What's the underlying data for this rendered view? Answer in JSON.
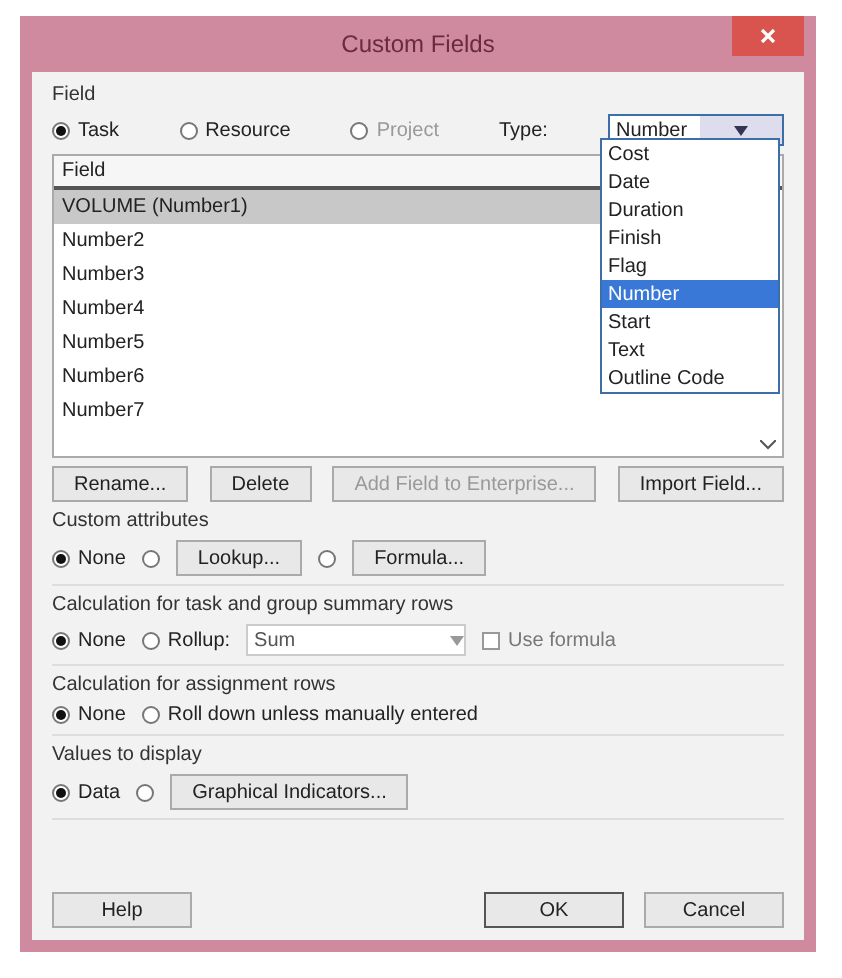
{
  "window": {
    "title": "Custom Fields"
  },
  "field": {
    "label": "Field",
    "entities": [
      {
        "label": "Task",
        "selected": true,
        "disabled": false
      },
      {
        "label": "Resource",
        "selected": false,
        "disabled": false
      },
      {
        "label": "Project",
        "selected": false,
        "disabled": true
      }
    ],
    "type_label": "Type:",
    "type_select": {
      "value": "Number",
      "expanded": true,
      "options": [
        {
          "label": "Cost",
          "selected": false
        },
        {
          "label": "Date",
          "selected": false
        },
        {
          "label": "Duration",
          "selected": false
        },
        {
          "label": "Finish",
          "selected": false
        },
        {
          "label": "Flag",
          "selected": false
        },
        {
          "label": "Number",
          "selected": true
        },
        {
          "label": "Start",
          "selected": false
        },
        {
          "label": "Text",
          "selected": false
        },
        {
          "label": "Outline Code",
          "selected": false
        }
      ]
    },
    "list": {
      "header": "Field",
      "rows": [
        {
          "label": "VOLUME (Number1)",
          "selected": true
        },
        {
          "label": "Number2",
          "selected": false
        },
        {
          "label": "Number3",
          "selected": false
        },
        {
          "label": "Number4",
          "selected": false
        },
        {
          "label": "Number5",
          "selected": false
        },
        {
          "label": "Number6",
          "selected": false
        },
        {
          "label": "Number7",
          "selected": false
        }
      ]
    },
    "buttons": [
      {
        "label": "Rename...",
        "disabled": false
      },
      {
        "label": "Delete",
        "disabled": false
      },
      {
        "label": "Add Field to Enterprise...",
        "disabled": true
      },
      {
        "label": "Import Field...",
        "disabled": false
      }
    ]
  },
  "sections": [
    {
      "label": "Custom attributes",
      "items": [
        {
          "kind": "radio",
          "label": "None",
          "selected": true
        },
        {
          "kind": "radio",
          "selected": false
        },
        {
          "kind": "button",
          "label": "Lookup..."
        },
        {
          "kind": "radio",
          "selected": false
        },
        {
          "kind": "button",
          "label": "Formula..."
        }
      ]
    },
    {
      "label": "Calculation for task and group summary rows",
      "items": [
        {
          "kind": "radio",
          "label": "None",
          "selected": true
        },
        {
          "kind": "radio",
          "label": "Rollup:",
          "selected": false
        },
        {
          "kind": "select",
          "label": "Sum"
        },
        {
          "kind": "checkbox",
          "label": "Use formula",
          "checked": false
        }
      ]
    },
    {
      "label": "Calculation for assignment rows",
      "items": [
        {
          "kind": "radio",
          "label": "None",
          "selected": true
        },
        {
          "kind": "radio",
          "label": "Roll down unless manually entered",
          "selected": false
        }
      ]
    },
    {
      "label": "Values to display",
      "items": [
        {
          "kind": "radio",
          "label": "Data",
          "selected": true
        },
        {
          "kind": "radio",
          "selected": false
        },
        {
          "kind": "button",
          "label": "Graphical Indicators..."
        }
      ]
    }
  ],
  "footer": [
    {
      "label": "Help",
      "default": false
    },
    {
      "label": "OK",
      "default": true
    },
    {
      "label": "Cancel",
      "default": false
    }
  ]
}
